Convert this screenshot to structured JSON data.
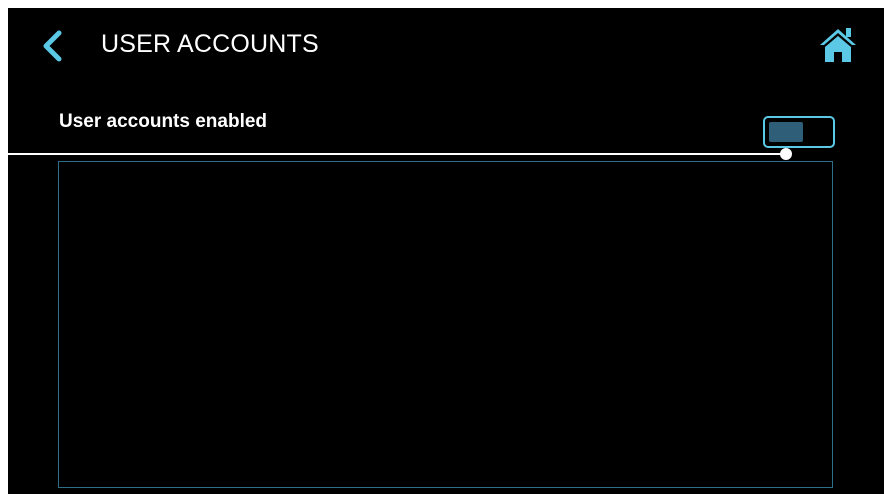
{
  "header": {
    "title": "USER ACCOUNTS",
    "back_icon": "chevron-left-icon",
    "home_icon": "home-icon"
  },
  "settings": {
    "user_accounts_enabled": {
      "label": "User accounts enabled",
      "toggle_state": "off"
    }
  },
  "colors": {
    "background": "#000000",
    "accent": "#5bc8e6",
    "toggle_knob": "#2f5f78",
    "panel_border": "#2e6f87",
    "text": "#ffffff"
  }
}
